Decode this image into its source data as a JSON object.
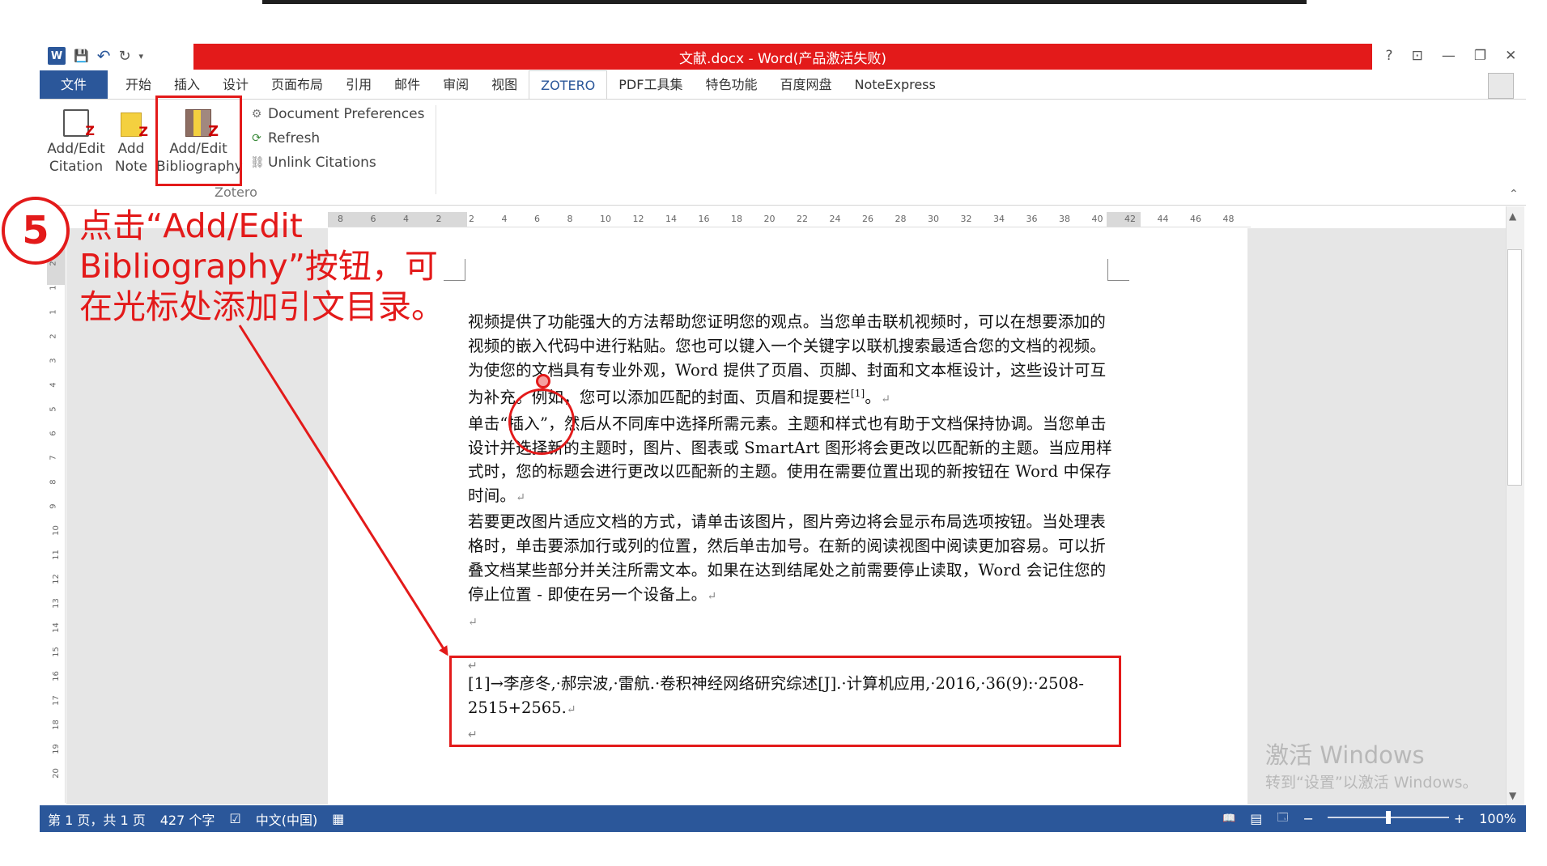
{
  "window": {
    "title": "文献.docx - Word(产品激活失败)",
    "help_icon": "?",
    "ribbon_display_icon": "⊡",
    "minimize_icon": "—",
    "restore_icon": "❐",
    "close_icon": "✕"
  },
  "qat": {
    "word_logo": "W",
    "save_icon": "💾",
    "undo_icon": "↶",
    "redo_icon": "↻",
    "customize_icon": "▾"
  },
  "tabs": [
    "文件",
    "开始",
    "插入",
    "设计",
    "页面布局",
    "引用",
    "邮件",
    "审阅",
    "视图",
    "ZOTERO",
    "PDF工具集",
    "特色功能",
    "百度网盘",
    "NoteExpress"
  ],
  "active_tab": "ZOTERO",
  "ribbon": {
    "buttons": [
      {
        "line1": "Add/Edit",
        "line2": "Citation"
      },
      {
        "line1": "Add",
        "line2": "Note"
      },
      {
        "line1": "Add/Edit",
        "line2": "Bibliography"
      }
    ],
    "commands": [
      "Document Preferences",
      "Refresh",
      "Unlink Citations"
    ],
    "group_label": "Zotero",
    "collapse_icon": "⌃"
  },
  "annotation": {
    "step_number": "5",
    "text": "点击“Add/Edit Bibliography”按钮，可在光标处添加引文目录。",
    "color": "#e31a1a"
  },
  "ruler": {
    "h_ticks": [
      "8",
      "6",
      "4",
      "2",
      "2",
      "4",
      "6",
      "8",
      "10",
      "12",
      "14",
      "16",
      "18",
      "20",
      "22",
      "24",
      "26",
      "28",
      "30",
      "32",
      "34",
      "36",
      "38",
      "40",
      "42",
      "44",
      "46",
      "48"
    ],
    "v_ticks": [
      "3",
      "2",
      "1",
      "1",
      "2",
      "3",
      "4",
      "5",
      "6",
      "7",
      "8",
      "9",
      "10",
      "11",
      "12",
      "13",
      "14",
      "15",
      "16",
      "17",
      "18",
      "19",
      "20"
    ],
    "tab_marker": "L"
  },
  "document": {
    "paragraphs": [
      "视频提供了功能强大的方法帮助您证明您的观点。当您单击联机视频时，可以在想要添加的视频的嵌入代码中进行粘贴。您也可以键入一个关键字以联机搜索最适合您的文档的视频。为使您的文档具有专业外观，Word 提供了页眉、页脚、封面和文本框设计，这些设计可互为补充。例如，您可以添加匹配的封面、页眉和提要栏",
      "单击“插入”，然后从不同库中选择所需元素。主题和样式也有助于文档保持协调。当您单击设计并选择新的主题时，图片、图表或 SmartArt 图形将会更改以匹配新的主题。当应用样式时，您的标题会进行更改以匹配新的主题。使用在需要位置出现的新按钮在 Word 中保存时间。",
      "若要更改图片适应文档的方式，请单击该图片，图片旁边将会显示布局选项按钮。当处理表格时，单击要添加行或列的位置，然后单击加号。在新的阅读视图中阅读更加容易。可以折叠文档某些部分并关注所需文本。如果在达到结尾处之前需要停止读取，Word 会记住您的停止位置 - 即使在另一个设备上。"
    ],
    "citation_mark": "[1]",
    "citation_tail": "。",
    "return_mark": "↵",
    "bibliography": "[1]→李彦冬,·郝宗波,·雷航.·卷积神经网络研究综述[J].·计算机应用,·2016,·36(9):·2508-2515+2565."
  },
  "watermark": {
    "line1": "激活 Windows",
    "line2": "转到“设置”以激活 Windows。"
  },
  "statusbar": {
    "page": "第 1 页，共 1 页",
    "words": "427 个字",
    "proof_icon": "☑",
    "language": "中文(中国)",
    "macro_icon": "▦",
    "read_mode_icon": "📖",
    "print_layout_icon": "▤",
    "web_layout_icon": "🗔",
    "zoom_out": "−",
    "zoom_in": "+",
    "zoom": "100%",
    "zoom_fraction": 0.5
  },
  "scroll": {
    "up_icon": "▲",
    "down_icon": "▼"
  }
}
